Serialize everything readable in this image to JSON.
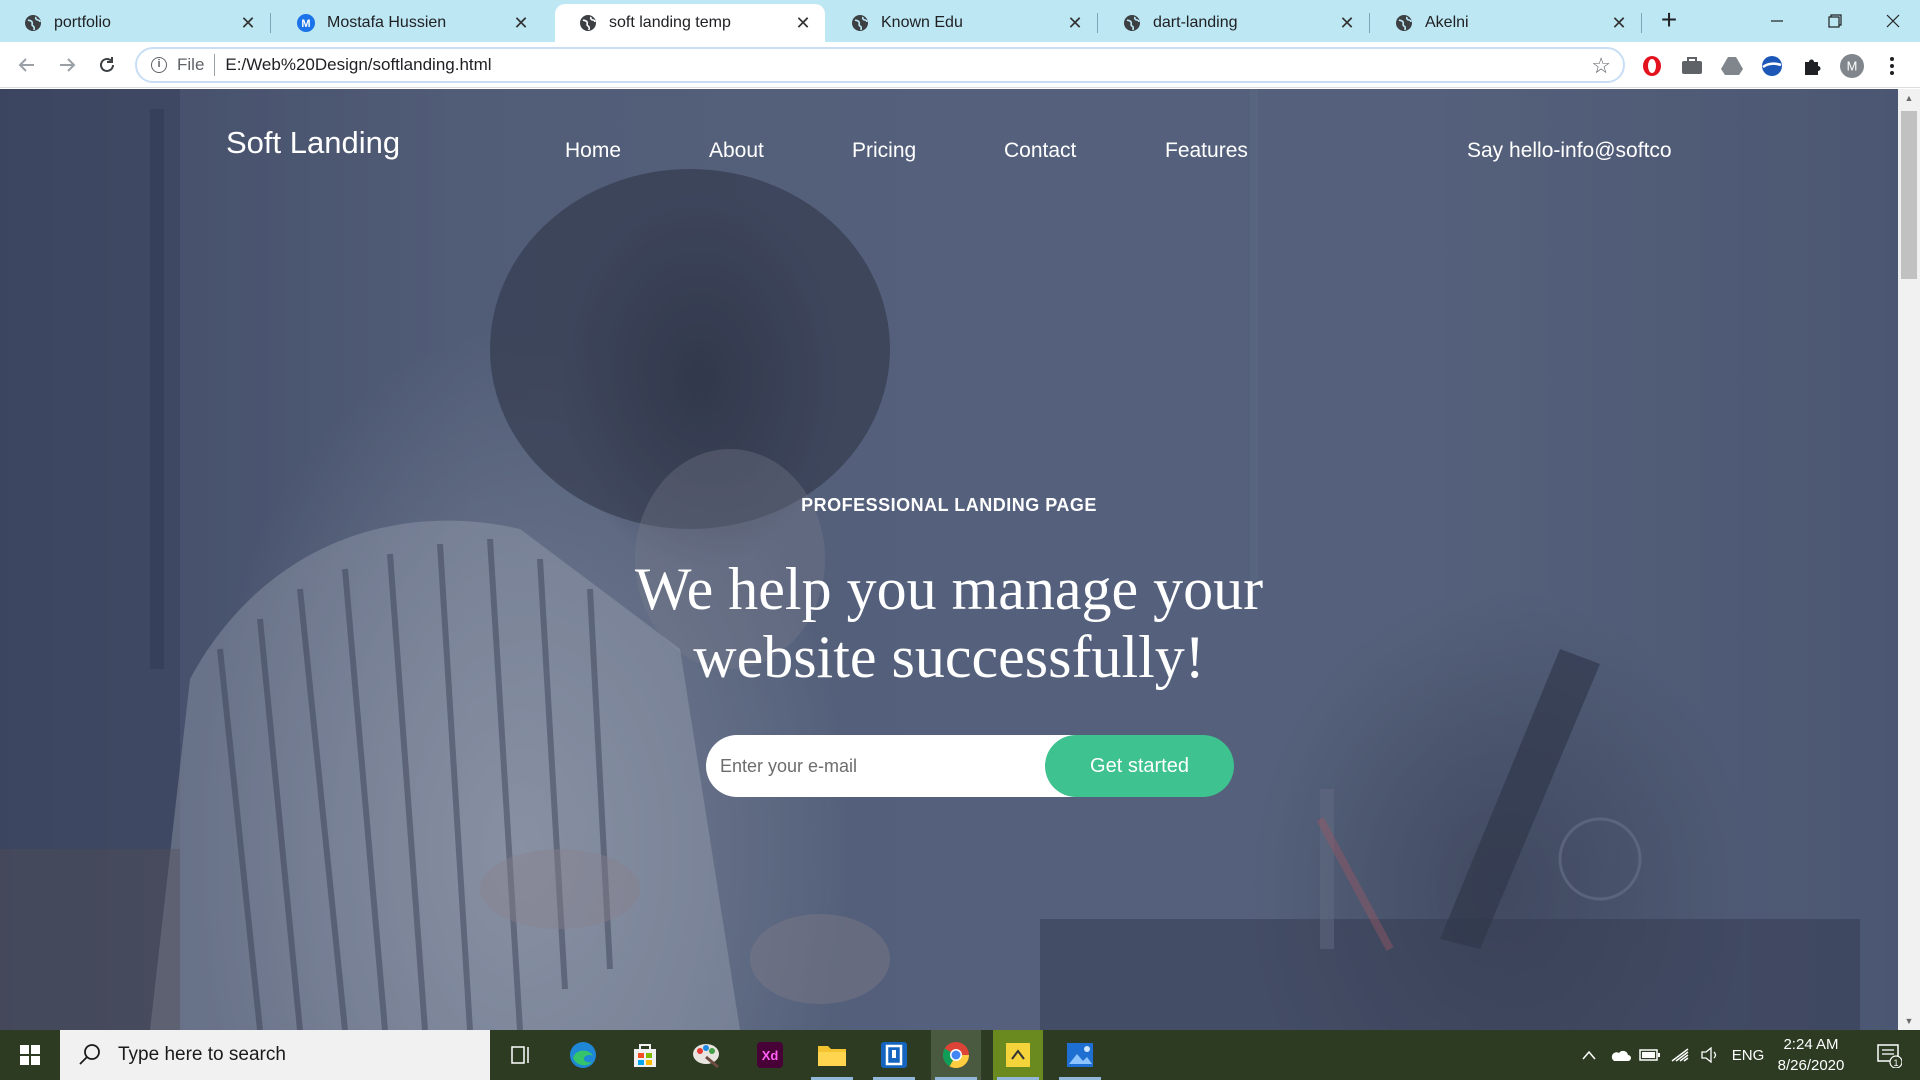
{
  "browser": {
    "tabs": [
      {
        "title": "portfolio",
        "icon": "globe-icon"
      },
      {
        "title": "Mostafa Hussien",
        "icon": "m-avatar-icon"
      },
      {
        "title": "soft landing temp",
        "icon": "globe-icon",
        "active": true
      },
      {
        "title": "Known Edu",
        "icon": "globe-icon"
      },
      {
        "title": "dart-landing",
        "icon": "globe-icon"
      },
      {
        "title": "Akelni",
        "icon": "globe-icon"
      }
    ],
    "close_glyph": "✕",
    "new_tab_glyph": "+",
    "address": {
      "scheme_label": "File",
      "url": "E:/Web%20Design/softlanding.html"
    },
    "profile_initial": "M",
    "colors": {
      "tabbar": "#bde7f3",
      "omnibox_border": "#c9def5"
    }
  },
  "page": {
    "brand": "Soft Landing",
    "nav": [
      "Home",
      "About",
      "Pricing",
      "Contact",
      "Features"
    ],
    "contact_text": "Say hello-info@softco",
    "eyebrow": "PROFESSIONAL LANDING PAGE",
    "headline_line1": "We help you manage your",
    "headline_line2": "website successfully!",
    "email_placeholder": "Enter your e-mail",
    "cta_label": "Get started",
    "colors": {
      "cta": "#3ec28f",
      "overlay": "#4a5570",
      "text": "#ffffff"
    }
  },
  "taskbar": {
    "search_placeholder": "Type here to search",
    "apps": [
      "task-view-icon",
      "edge-icon",
      "store-icon",
      "paint-icon",
      "xd-icon",
      "file-explorer-icon",
      "app-icon",
      "chrome-icon",
      "sticky-icon",
      "photos-icon"
    ],
    "language": "ENG",
    "time": "2:24 AM",
    "date": "8/26/2020",
    "notification_count": "1"
  }
}
